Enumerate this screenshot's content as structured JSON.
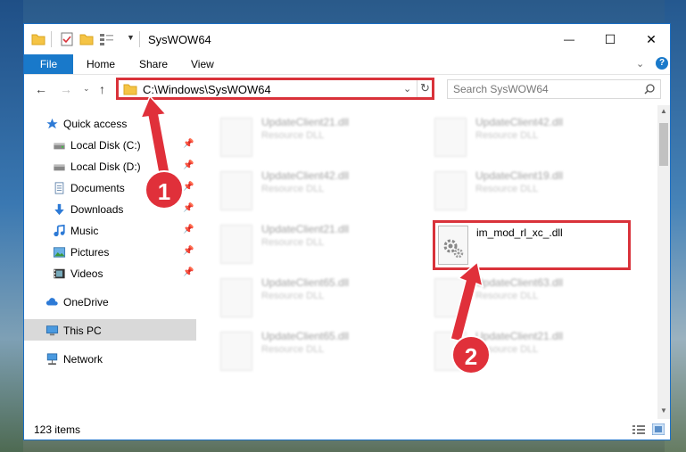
{
  "window": {
    "title": "SysWOW64",
    "controls": {
      "minimize": "—",
      "maximize": "☐",
      "close": "✕"
    }
  },
  "ribbon": {
    "tabs": [
      "File",
      "Home",
      "Share",
      "View"
    ]
  },
  "navigation": {
    "address": "C:\\Windows\\SysWOW64",
    "search_placeholder": "Search SysWOW64"
  },
  "sidebar": {
    "items": [
      {
        "label": "Quick access",
        "icon": "star-icon"
      },
      {
        "label": "Local Disk (C:)",
        "icon": "drive-icon",
        "pinned": true
      },
      {
        "label": "Local Disk (D:)",
        "icon": "drive-icon",
        "pinned": true
      },
      {
        "label": "Documents",
        "icon": "document-icon",
        "pinned": true
      },
      {
        "label": "Downloads",
        "icon": "download-icon",
        "pinned": true
      },
      {
        "label": "Music",
        "icon": "music-icon",
        "pinned": true
      },
      {
        "label": "Pictures",
        "icon": "pictures-icon",
        "pinned": true
      },
      {
        "label": "Videos",
        "icon": "videos-icon",
        "pinned": true
      },
      {
        "label": "OneDrive",
        "icon": "cloud-icon"
      },
      {
        "label": "This PC",
        "icon": "computer-icon",
        "selected": true
      },
      {
        "label": "Network",
        "icon": "network-icon"
      }
    ]
  },
  "files": [
    {
      "name": "UpdateClient21.dll",
      "desc": "Resource DLL"
    },
    {
      "name": "UpdateClient42.dll",
      "desc": "Resource DLL"
    },
    {
      "name": "UpdateClient42.dll",
      "desc": "Resource DLL"
    },
    {
      "name": "UpdateClient19.dll",
      "desc": "Resource DLL"
    },
    {
      "name": "UpdateClient21.dll",
      "desc": "Resource DLL"
    },
    {
      "name": "im_mod_rl_xc_.dll",
      "desc": ""
    },
    {
      "name": "UpdateClient65.dll",
      "desc": "Resource DLL"
    },
    {
      "name": "UpdateClient63.dll",
      "desc": "Resource DLL"
    },
    {
      "name": "UpdateClient65.dll",
      "desc": "Resource DLL"
    },
    {
      "name": "UpdateClient21.dll",
      "desc": "Resource DLL"
    }
  ],
  "status": {
    "item_count": "123 items"
  },
  "annotations": {
    "step1": "1",
    "step2": "2"
  },
  "colors": {
    "accent": "#1979ca",
    "highlight": "#d9323a"
  }
}
